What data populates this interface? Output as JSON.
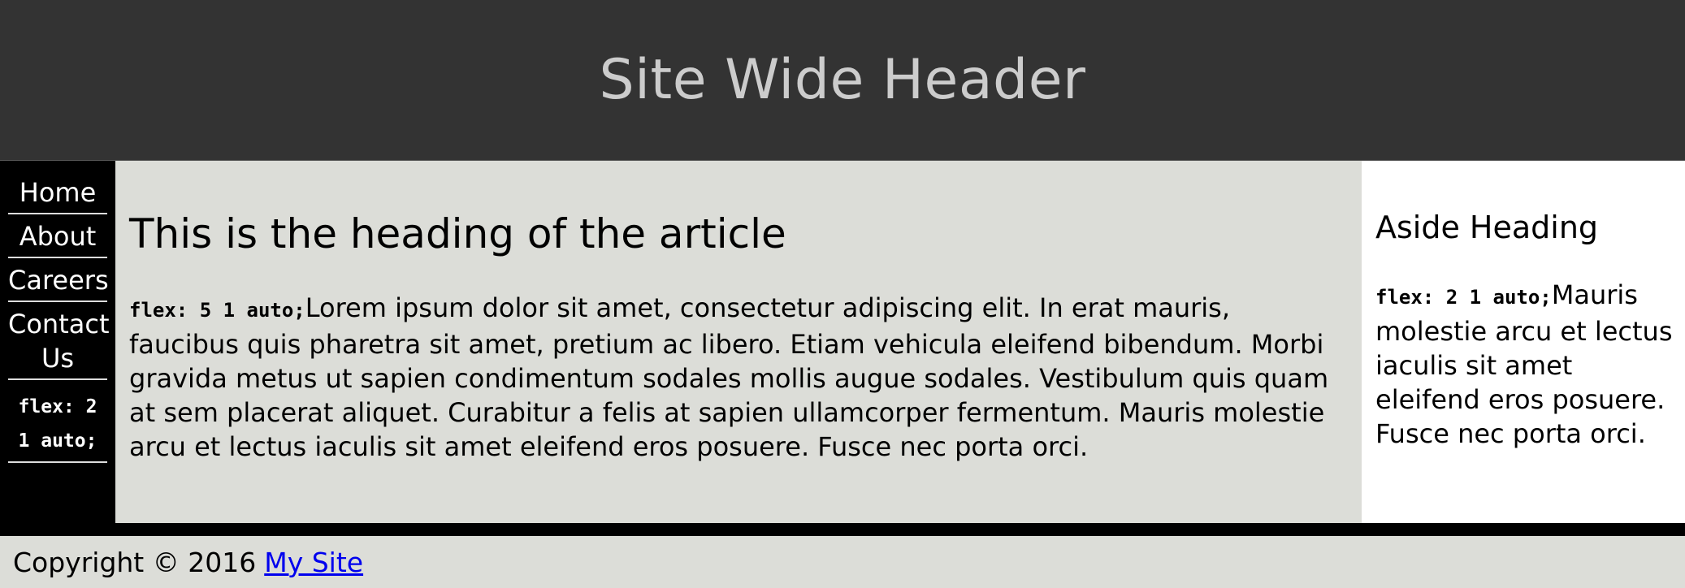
{
  "header": {
    "title": "Site Wide Header"
  },
  "nav": {
    "items": [
      {
        "label": "Home"
      },
      {
        "label": "About"
      },
      {
        "label": "Careers"
      },
      {
        "label": "Contact Us"
      }
    ],
    "note": "flex: 2 1 auto;"
  },
  "article": {
    "heading": "This is the heading of the article",
    "code": "flex: 5 1 auto;",
    "body": "Lorem ipsum dolor sit amet, consectetur adipiscing elit. In erat mauris, faucibus quis pharetra sit amet, pretium ac libero. Etiam vehicula eleifend bibendum. Morbi gravida metus ut sapien condimentum sodales mollis augue sodales. Vestibulum quis quam at sem placerat aliquet. Curabitur a felis at sapien ullamcorper fermentum. Mauris molestie arcu et lectus iaculis sit amet eleifend eros posuere. Fusce nec porta orci."
  },
  "aside": {
    "heading": "Aside Heading",
    "code": "flex: 2 1 auto;",
    "body": "Mauris molestie arcu et lectus iaculis sit amet eleifend eros posuere. Fusce nec porta orci."
  },
  "footer": {
    "copyright": "Copyright © 2016",
    "link_label": "My Site"
  },
  "colors": {
    "header_bg": "#333333",
    "header_text": "#cccccc",
    "article_bg": "#dcddd8",
    "nav_bg": "#000000",
    "link": "#0000ee"
  }
}
